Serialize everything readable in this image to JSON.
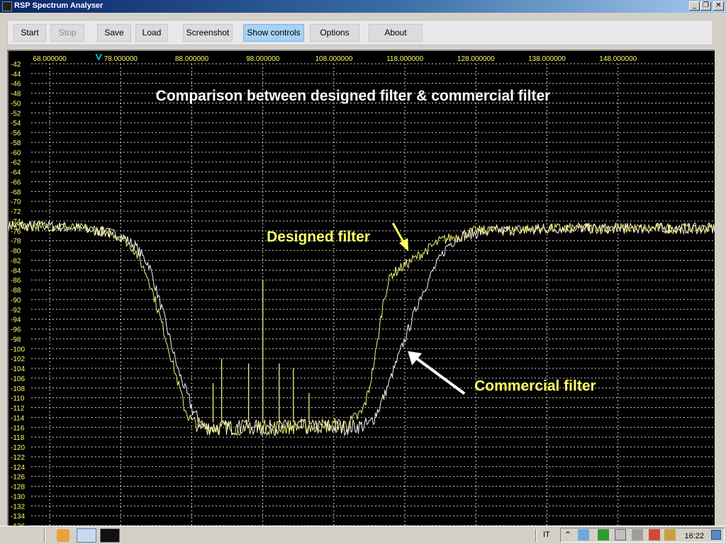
{
  "window": {
    "title": "RSP Spectrum Analyser",
    "minimize_glyph": "_",
    "restore_glyph": "❐",
    "close_glyph": "✕"
  },
  "toolbar": {
    "start": "Start",
    "stop": "Stop",
    "save": "Save",
    "load": "Load",
    "screenshot": "Screenshot",
    "show_controls": "Show controls",
    "options": "Options",
    "about": "About"
  },
  "colors": {
    "background": "#000000",
    "grid": "#ffffff",
    "axis_text": "#ffff66",
    "designed_trace": "#ffff80",
    "commercial_trace": "#ffffff",
    "annotation_designed": "#ffff66",
    "annotation_commercial": "#ffff66",
    "marker": "#00e5ff"
  },
  "chart_data": {
    "type": "line",
    "title": "Comparison between designed filter & commercial filter",
    "x_tick_labels": [
      "68.000000",
      "78.000000",
      "88.000000",
      "98.000000",
      "108.000000",
      "118.000000",
      "128.000000",
      "138.000000",
      "148.000000"
    ],
    "xlim": [
      62.2,
      161.6
    ],
    "ylim": [
      -136,
      -42
    ],
    "y_tick_step": 2,
    "marker_x": 74.9,
    "grid": true,
    "series": [
      {
        "name": "Designed filter",
        "x": [
          62.2,
          68,
          72,
          75,
          78,
          80,
          82,
          84,
          85.5,
          87,
          88,
          89,
          90,
          100,
          110,
          112,
          113,
          114,
          115,
          116,
          118,
          120,
          123,
          128,
          140,
          161.6
        ],
        "y": [
          -75,
          -75,
          -75.5,
          -76,
          -77,
          -80,
          -86,
          -96,
          -104,
          -112,
          -115,
          -115.5,
          -116,
          -116,
          -115.5,
          -113,
          -108,
          -100,
          -90,
          -85,
          -83,
          -81,
          -78,
          -76,
          -75.5,
          -75.5
        ]
      },
      {
        "name": "Commercial filter",
        "x": [
          62.2,
          68,
          72,
          75,
          78,
          80,
          82,
          84,
          86,
          88,
          89,
          90,
          100,
          110,
          113,
          114,
          115,
          116,
          117,
          118,
          119,
          120,
          122,
          124,
          126,
          130,
          140,
          161.6
        ],
        "y": [
          -75,
          -75,
          -75.5,
          -76,
          -77,
          -79,
          -83,
          -93,
          -104,
          -112,
          -115,
          -116,
          -116,
          -116,
          -115.5,
          -113,
          -110,
          -106,
          -102,
          -98,
          -94,
          -90,
          -84,
          -79,
          -77,
          -76,
          -75.5,
          -75.5
        ]
      }
    ],
    "spurs": [
      {
        "x": 91.0,
        "y": -107
      },
      {
        "x": 92.2,
        "y": -102
      },
      {
        "x": 96.0,
        "y": -103
      },
      {
        "x": 98.0,
        "y": -86
      },
      {
        "x": 100.3,
        "y": -103
      },
      {
        "x": 102.3,
        "y": -104
      },
      {
        "x": 104.5,
        "y": -109
      }
    ],
    "annotations": [
      {
        "text": "Designed filter",
        "pointer_x": 118.5,
        "pointer_y": -80.2
      },
      {
        "text": "Commercial filter",
        "pointer_x": 118.4,
        "pointer_y": -100.5
      }
    ]
  },
  "taskbar": {
    "language": "IT",
    "tray_chevron": "⌃",
    "clock": "16:22"
  }
}
